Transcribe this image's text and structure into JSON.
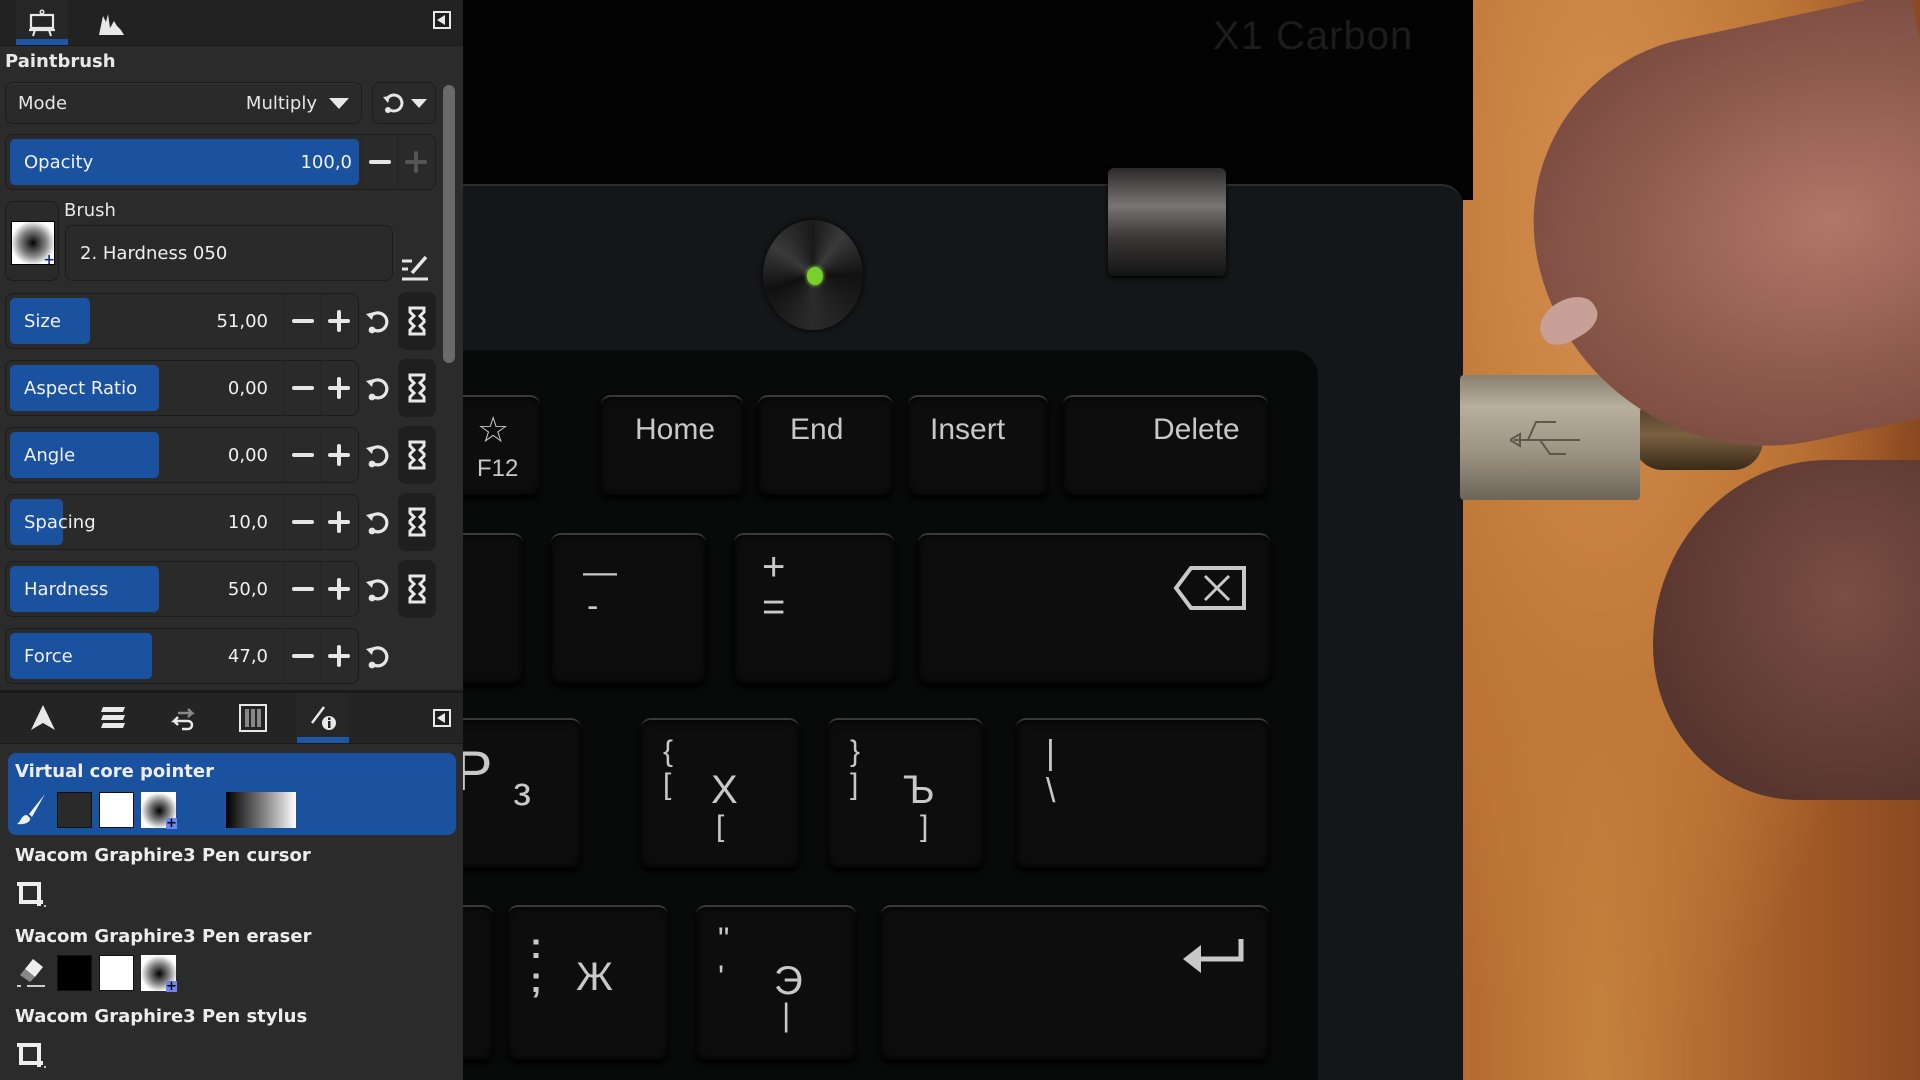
{
  "toolbar_top": {
    "tabs": [
      {
        "icon": "easel-icon",
        "active": true
      },
      {
        "icon": "histogram-icon",
        "active": false
      }
    ]
  },
  "tool_options": {
    "title": "Paintbrush",
    "mode": {
      "label": "Mode",
      "value": "Multiply"
    },
    "opacity": {
      "label": "Opacity",
      "value": "100,0",
      "fraction": 1.0
    },
    "brush": {
      "label": "Brush",
      "name": "2. Hardness 050"
    },
    "sliders": [
      {
        "label": "Size",
        "value": "51,00",
        "fraction": 0.1,
        "linked": true
      },
      {
        "label": "Aspect Ratio",
        "value": "0,00",
        "fraction": 0.5,
        "linked": true
      },
      {
        "label": "Angle",
        "value": "0,00",
        "fraction": 0.5,
        "linked": true
      },
      {
        "label": "Spacing",
        "value": "10,0",
        "fraction": 0.1,
        "linked": true
      },
      {
        "label": "Hardness",
        "value": "50,0",
        "fraction": 0.5,
        "linked": true
      },
      {
        "label": "Force",
        "value": "47,0",
        "fraction": 0.47,
        "linked": false
      }
    ]
  },
  "toolbar_bottom": {
    "tabs": [
      {
        "icon": "tool-options-arrow-icon",
        "active": false
      },
      {
        "icon": "layers-icon",
        "active": false
      },
      {
        "icon": "undo-history-icon",
        "active": false
      },
      {
        "icon": "channels-icon",
        "active": false
      },
      {
        "icon": "device-status-icon",
        "active": true
      }
    ]
  },
  "device_status": {
    "devices": [
      {
        "name": "Virtual core pointer",
        "tool": "paintbrush",
        "fg": "#2a2a2a",
        "bg": "#ffffff",
        "brush": "hardness-050",
        "gradient": true,
        "selected": true
      },
      {
        "name": "Wacom Graphire3 Pen cursor",
        "tool": "crop",
        "selected": false
      },
      {
        "name": "Wacom Graphire3 Pen eraser",
        "tool": "eraser",
        "fg": "#000000",
        "bg": "#ffffff",
        "brush": "hardness-050",
        "selected": false
      },
      {
        "name": "Wacom Graphire3 Pen stylus",
        "tool": "crop",
        "selected": false
      }
    ]
  },
  "canvas_photo": {
    "brand_text": "X1 Carbon",
    "keys_row1": [
      "F12",
      "Home",
      "End",
      "Insert",
      "Delete"
    ],
    "f12_icon": "star-icon",
    "keys_row2": [
      {
        "top": "—",
        "bottom": "-"
      },
      {
        "top": "+",
        "bottom": "="
      },
      {
        "icon": "backspace-icon"
      }
    ],
    "keys_row3": [
      {
        "latin": "P",
        "cyr": "з"
      },
      {
        "top": "{",
        "bottom": "[",
        "latin": "X",
        "extra": "["
      },
      {
        "top": "}",
        "bottom": "]",
        "latin": "Ъ",
        "extra": "]"
      },
      {
        "top": "|",
        "bottom": "\\"
      }
    ],
    "keys_row4": [
      {
        "top": ":",
        "bottom": ";",
        "cyr": "Ж"
      },
      {
        "top": "\"",
        "bottom": "'",
        "cyr": "Э",
        "extra": "|"
      },
      {
        "icon": "enter-icon"
      }
    ],
    "colors": {
      "led": "#7ad02a",
      "wood": "#c07838"
    }
  },
  "colors": {
    "accent": "#1a52a0",
    "panel_bg": "#2b2b2b",
    "text": "#e6e6e6"
  }
}
